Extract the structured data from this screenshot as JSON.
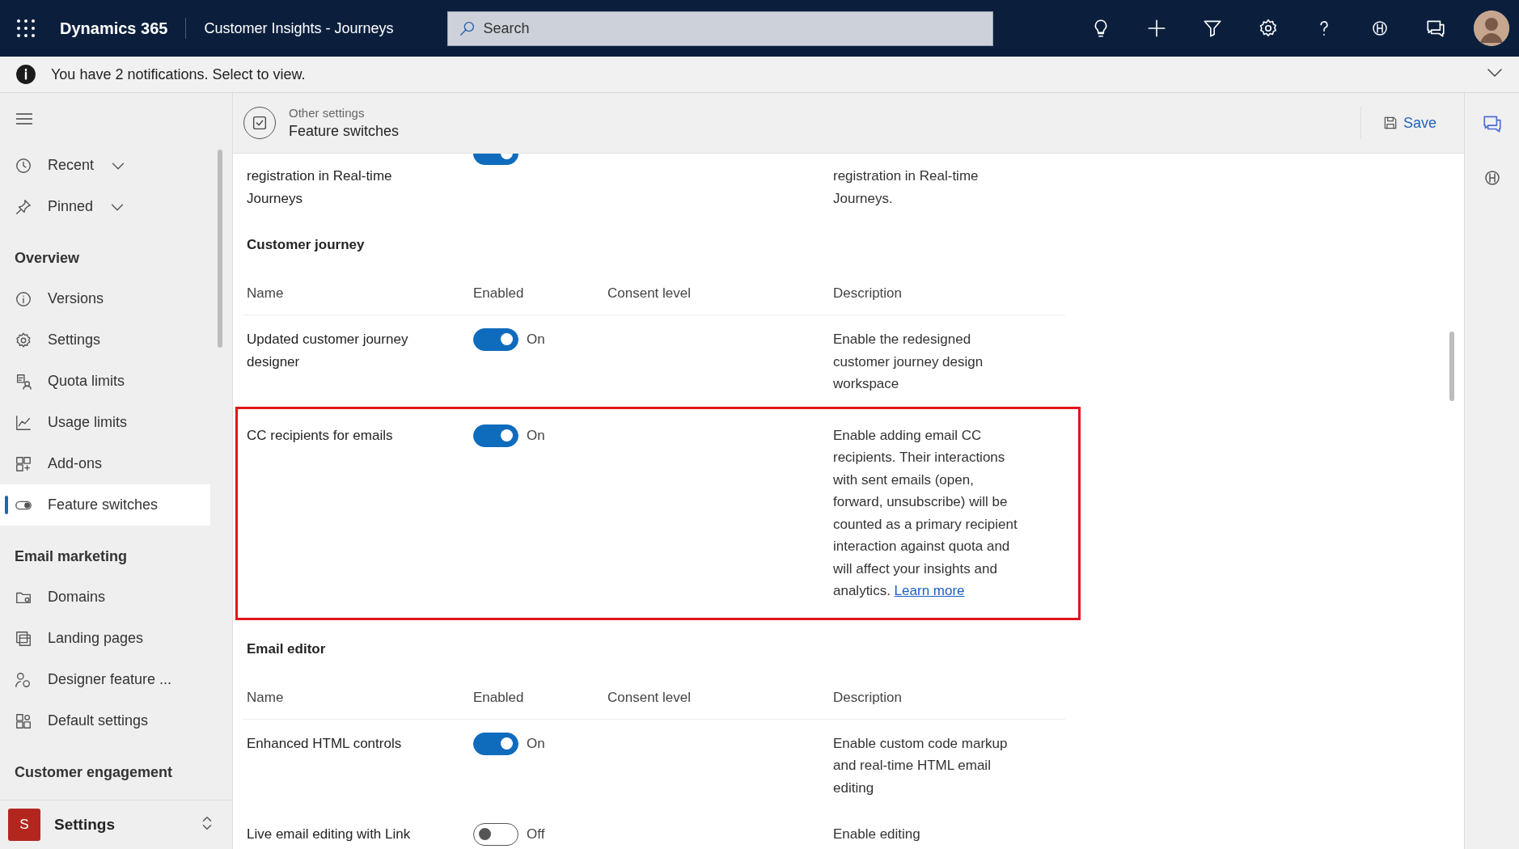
{
  "top_bar": {
    "app_name": "Dynamics 365",
    "area": "Customer Insights - Journeys",
    "search": {
      "placeholder": "Search"
    }
  },
  "notification": {
    "text": "You have 2 notifications. Select to view."
  },
  "sidebar": {
    "items": [
      {
        "kind": "expander",
        "label": "Recent",
        "expanded": false
      },
      {
        "kind": "expander",
        "label": "Pinned",
        "expanded": false
      },
      {
        "kind": "heading",
        "label": "Overview"
      },
      {
        "kind": "item",
        "label": "Versions",
        "selected": false
      },
      {
        "kind": "item",
        "label": "Settings",
        "selected": false
      },
      {
        "kind": "item",
        "label": "Quota limits",
        "selected": false
      },
      {
        "kind": "item",
        "label": "Usage limits",
        "selected": false
      },
      {
        "kind": "item",
        "label": "Add-ons",
        "selected": false
      },
      {
        "kind": "item",
        "label": "Feature switches",
        "selected": true
      },
      {
        "kind": "heading",
        "label": "Email marketing"
      },
      {
        "kind": "item",
        "label": "Domains",
        "selected": false
      },
      {
        "kind": "item",
        "label": "Landing pages",
        "selected": false
      },
      {
        "kind": "item",
        "label": "Designer feature ...",
        "selected": false
      },
      {
        "kind": "item",
        "label": "Default settings",
        "selected": false
      },
      {
        "kind": "heading",
        "label": "Customer engagement"
      }
    ],
    "area_switcher": {
      "badge": "S",
      "label": "Settings"
    }
  },
  "header": {
    "breadcrumb": "Other settings",
    "title": "Feature switches",
    "save": "Save"
  },
  "content": {
    "cut_row": {
      "name": "registration in Real-time Journeys",
      "on": true,
      "description": "registration in Real-time Journeys."
    },
    "sections": [
      {
        "title": "Customer journey",
        "columns": [
          "Name",
          "Enabled",
          "Consent level",
          "Description"
        ],
        "rows": [
          {
            "name": "Updated customer journey designer",
            "on": true,
            "state_label": "On",
            "description": "Enable the redesigned customer journey design workspace",
            "highlighted": false
          },
          {
            "name": "CC recipients for emails",
            "on": true,
            "state_label": "On",
            "description": "Enable adding email CC recipients. Their interactions with sent emails (open, forward, unsubscribe) will be counted as a primary recipient interaction against quota and will affect your insights and analytics.",
            "link": "Learn more",
            "highlighted": true
          }
        ]
      },
      {
        "title": "Email editor",
        "columns": [
          "Name",
          "Enabled",
          "Consent level",
          "Description"
        ],
        "rows": [
          {
            "name": "Enhanced HTML controls",
            "on": true,
            "state_label": "On",
            "description": "Enable custom code markup and real-time HTML email editing",
            "highlighted": false
          },
          {
            "name": "Live email editing with Link",
            "on": false,
            "state_label": "Off",
            "description": "Enable editing",
            "highlighted": false
          }
        ]
      }
    ]
  }
}
